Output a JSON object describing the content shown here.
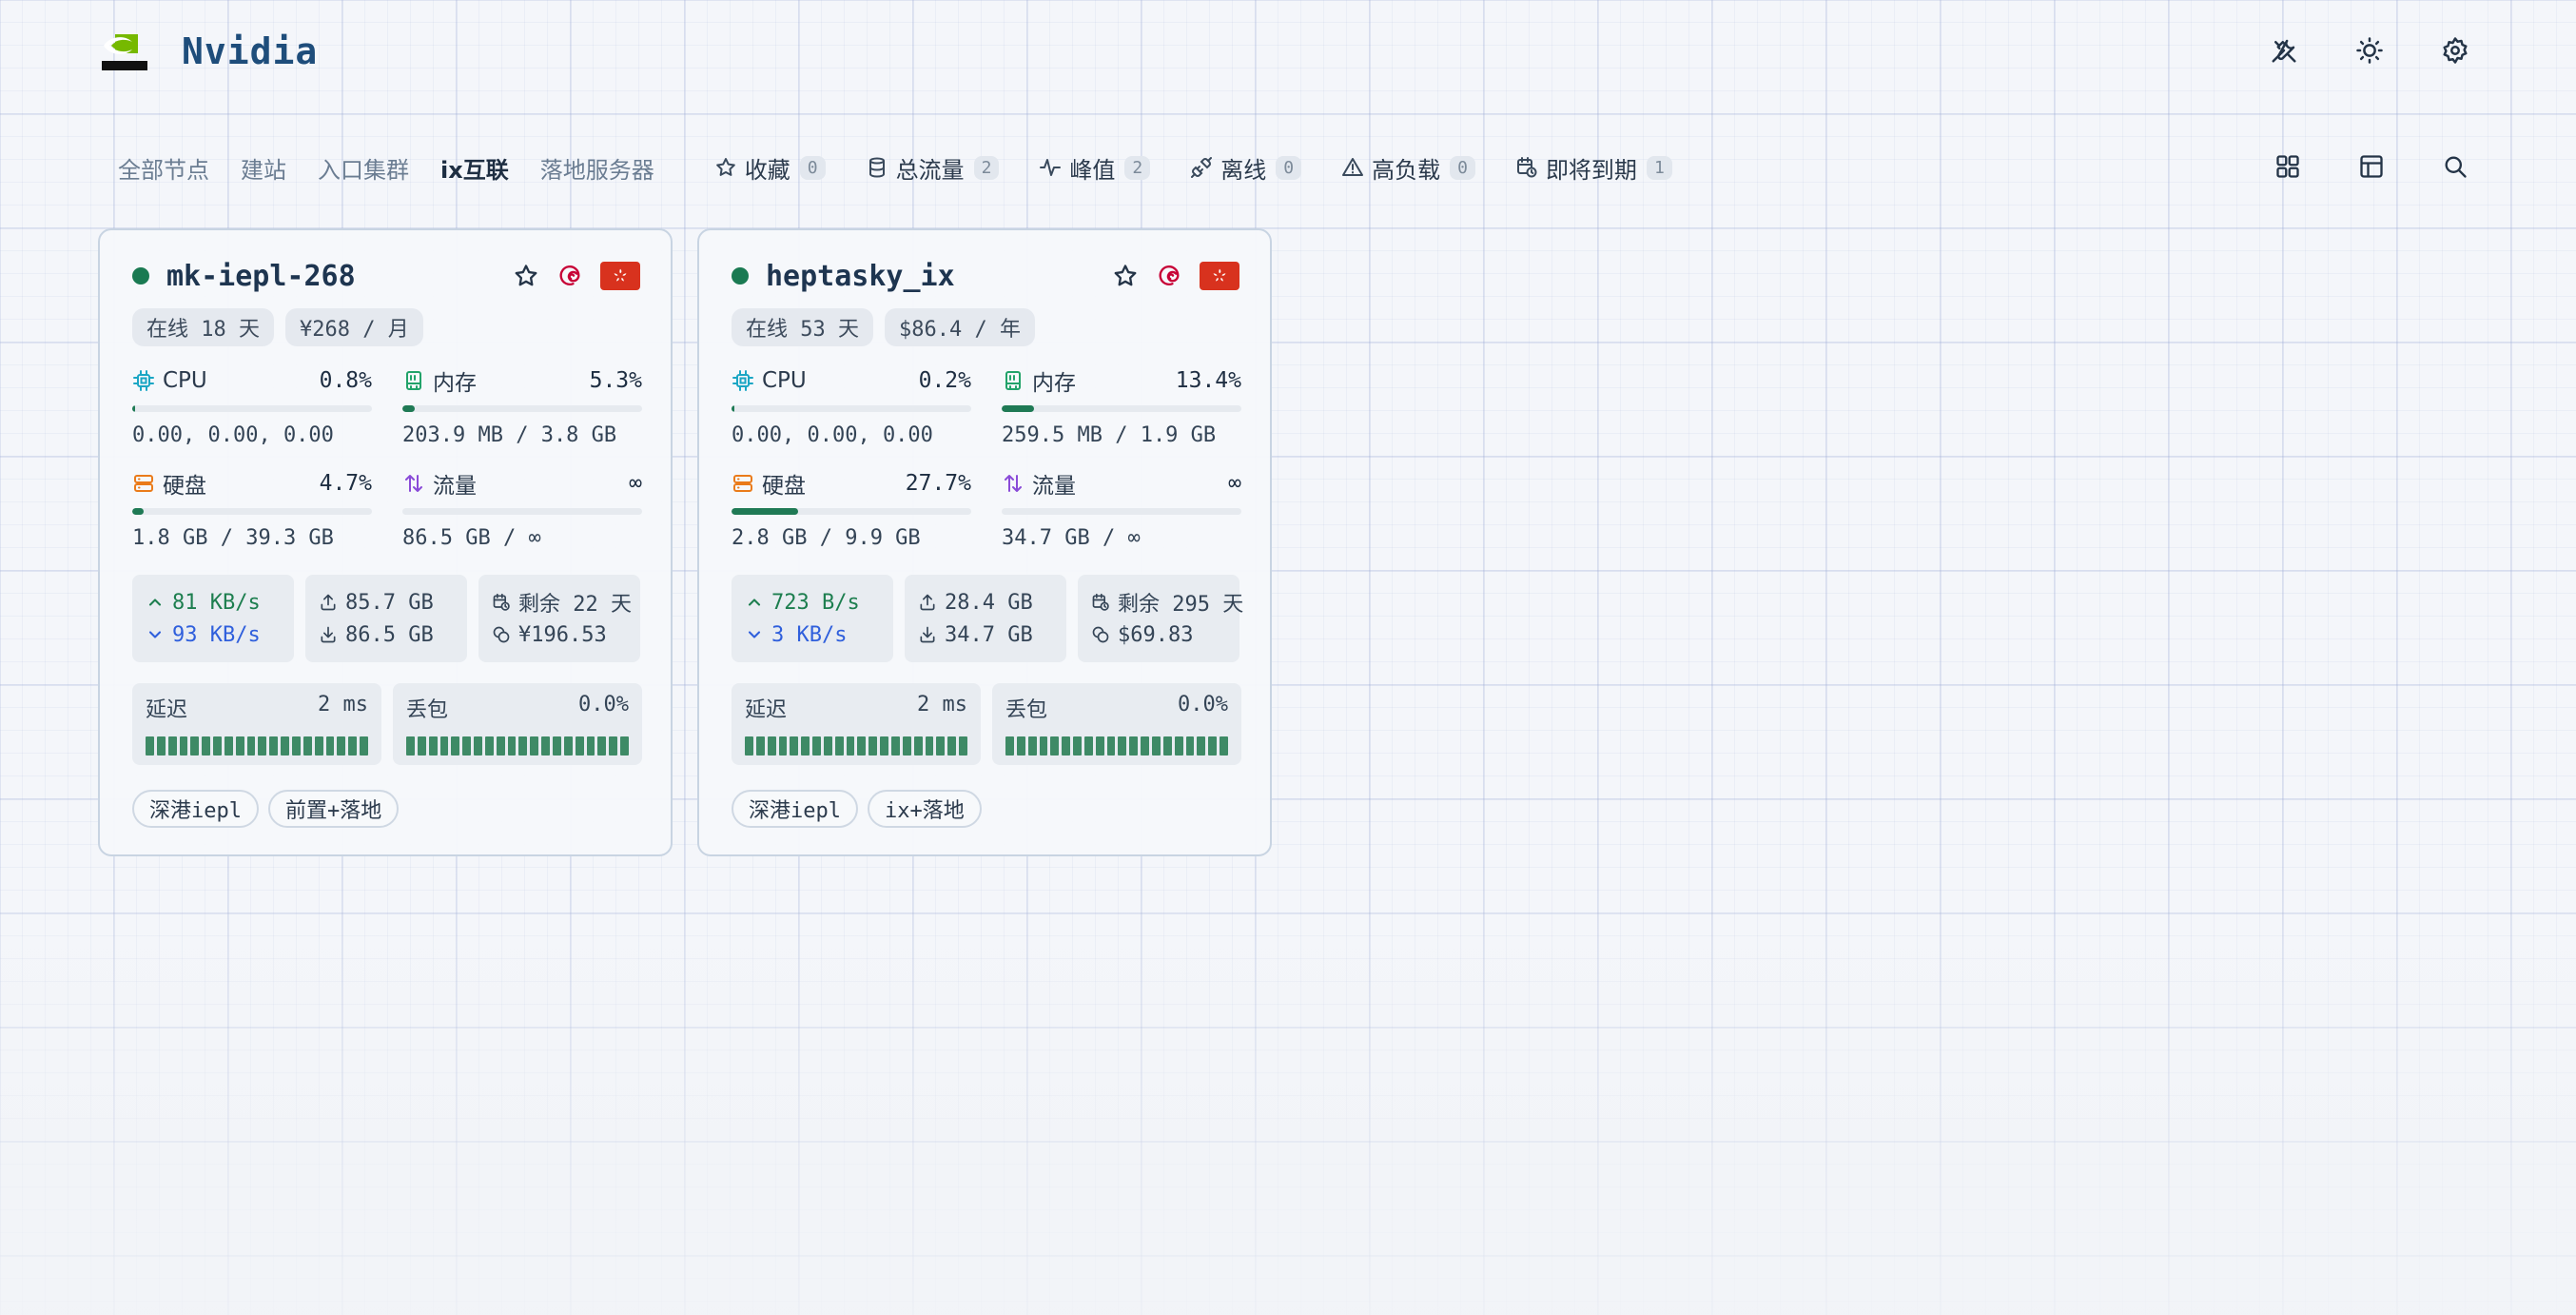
{
  "header": {
    "brand": "Nvidia"
  },
  "icons": {
    "top": [
      "tools-icon",
      "sun-icon",
      "gear-icon"
    ],
    "view": [
      "grid-icon",
      "table-icon",
      "search-icon"
    ]
  },
  "nav": {
    "tabs": [
      "全部节点",
      "建站",
      "入口集群",
      "ix互联",
      "落地服务器"
    ],
    "active_index": 3,
    "filters": [
      {
        "label": "收藏",
        "count": "0",
        "icon": "star-icon"
      },
      {
        "label": "总流量",
        "count": "2",
        "icon": "database-icon"
      },
      {
        "label": "峰值",
        "count": "2",
        "icon": "activity-icon"
      },
      {
        "label": "离线",
        "count": "0",
        "icon": "unplug-icon"
      },
      {
        "label": "高负载",
        "count": "0",
        "icon": "warning-icon"
      },
      {
        "label": "即将到期",
        "count": "1",
        "icon": "calendar-clock-icon"
      }
    ]
  },
  "colors": {
    "online": "#1a7a52",
    "bar_fill": "#1f7a55",
    "upload": "#1d7e4f",
    "download": "#2f5fdc",
    "flag_red": "#d8321e"
  },
  "cards": [
    {
      "name": "mk-iepl-268",
      "uptime": "在线 18 天",
      "price": "¥268 / 月",
      "cpu": {
        "label": "CPU",
        "value": "0.8%",
        "percent": 0.8,
        "detail": "0.00, 0.00, 0.00"
      },
      "mem": {
        "label": "内存",
        "value": "5.3%",
        "percent": 5.3,
        "detail": "203.9 MB / 3.8 GB"
      },
      "disk": {
        "label": "硬盘",
        "value": "4.7%",
        "percent": 4.7,
        "detail": "1.8 GB / 39.3 GB"
      },
      "traffic": {
        "label": "流量",
        "value": "∞",
        "percent": 0,
        "detail": "86.5 GB / ∞"
      },
      "speed_up": "81 KB/s",
      "speed_down": "93 KB/s",
      "total_up": "85.7 GB",
      "total_down": "86.5 GB",
      "remaining": "剩余 22 天",
      "remaining_value": "¥196.53",
      "latency": {
        "label": "延迟",
        "value": "2 ms"
      },
      "loss": {
        "label": "丢包",
        "value": "0.0%"
      },
      "tags": [
        "深港iepl",
        "前置+落地"
      ]
    },
    {
      "name": "heptasky_ix",
      "uptime": "在线 53 天",
      "price": "$86.4 / 年",
      "cpu": {
        "label": "CPU",
        "value": "0.2%",
        "percent": 0.2,
        "detail": "0.00, 0.00, 0.00"
      },
      "mem": {
        "label": "内存",
        "value": "13.4%",
        "percent": 13.4,
        "detail": "259.5 MB / 1.9 GB"
      },
      "disk": {
        "label": "硬盘",
        "value": "27.7%",
        "percent": 27.7,
        "detail": "2.8 GB / 9.9 GB"
      },
      "traffic": {
        "label": "流量",
        "value": "∞",
        "percent": 0,
        "detail": "34.7 GB / ∞"
      },
      "speed_up": "723 B/s",
      "speed_down": "3 KB/s",
      "total_up": "28.4 GB",
      "total_down": "34.7 GB",
      "remaining": "剩余 295 天",
      "remaining_value": "$69.83",
      "latency": {
        "label": "延迟",
        "value": "2 ms"
      },
      "loss": {
        "label": "丢包",
        "value": "0.0%"
      },
      "tags": [
        "深港iepl",
        "ix+落地"
      ]
    }
  ]
}
